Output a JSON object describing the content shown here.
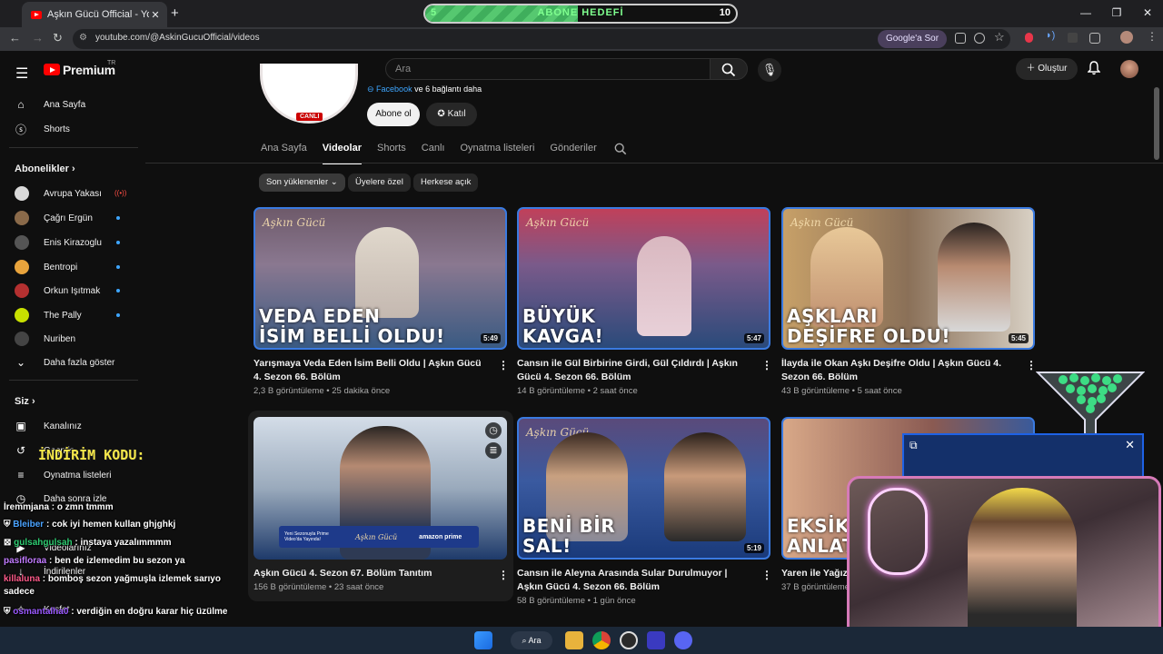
{
  "browser": {
    "tab_title": "Aşkın Gücü Official - YouTube",
    "tab_close": "✕",
    "new_tab": "+",
    "url": "youtube.com/@AskinGucuOfficial/videos",
    "google_sor": "Google'a Sor",
    "window_controls": [
      "—",
      "❐",
      "✕"
    ]
  },
  "abone_hedefi": {
    "label": "ABONE HEDEFİ",
    "start": "5",
    "end": "10",
    "progress_fraction": 0.49,
    "color": "#56c870"
  },
  "youtube": {
    "premium": "Premium",
    "premium_region": "TR",
    "search_placeholder": "Ara",
    "create_label": "Oluştur",
    "brand_color": "#ff0000"
  },
  "sidebar": {
    "main": [
      {
        "label": "Ana Sayfa",
        "icon": "home-icon"
      },
      {
        "label": "Shorts",
        "icon": "shorts-icon"
      }
    ],
    "subs_header": "Abonelikler",
    "subscriptions": [
      {
        "label": "Avrupa Yakası",
        "live": true
      },
      {
        "label": "Çağrı Ergün",
        "dot": true
      },
      {
        "label": "Enis Kirazoglu",
        "dot": true
      },
      {
        "label": "Bentropi",
        "dot": true
      },
      {
        "label": "Orkun Işıtmak",
        "dot": true
      },
      {
        "label": "The Pally",
        "dot": true
      },
      {
        "label": "Nuriben",
        "dot": false
      }
    ],
    "show_more": "Daha fazla göster",
    "you_header": "Siz",
    "you_items": [
      {
        "label": "Kanalınız",
        "icon": "channel-icon"
      },
      {
        "label": "Geçmiş",
        "icon": "history-icon"
      },
      {
        "label": "Oynatma listeleri",
        "icon": "playlist-icon"
      },
      {
        "label": "Daha sonra izle",
        "icon": "watch-later-icon"
      },
      {
        "label": "Videolarınız",
        "icon": "videos-icon"
      },
      {
        "label": "İndirilenler",
        "icon": "download-icon"
      },
      {
        "label": "Keşfet",
        "icon": "explore-icon"
      }
    ]
  },
  "channel": {
    "live_badge": "CANLI",
    "links_fb": "Facebook",
    "links_more": "ve 6 bağlantı daha",
    "subscribe": "Abone ol",
    "join": "Katıl",
    "tabs": [
      "Ana Sayfa",
      "Videolar",
      "Shorts",
      "Canlı",
      "Oynatma listeleri",
      "Gönderiler"
    ],
    "active_tab": "Videolar",
    "chips": [
      "Son yüklenenler",
      "Üyelere özel",
      "Herkese açık"
    ]
  },
  "videos": [
    {
      "title": "Yarışmaya Veda Eden İsim Belli Oldu | Aşkın Gücü 4. Sezon 66. Bölüm",
      "views": "2,3 B görüntüleme",
      "age": "25 dakika önce",
      "duration": "5:49",
      "caption1": "VEDA EDEN",
      "caption2": "İSİM BELLİ OLDU!",
      "brand": "Aşkın Gücü"
    },
    {
      "title": "Cansın ile Gül Birbirine Girdi, Gül Çıldırdı | Aşkın Gücü 4. Sezon 66. Bölüm",
      "views": "14 B görüntüleme",
      "age": "2 saat önce",
      "duration": "5:47",
      "caption1": "BÜYÜK",
      "caption2": "KAVGA!",
      "brand": "Aşkın Gücü"
    },
    {
      "title": "İlayda ile Okan Aşkı Deşifre Oldu | Aşkın Gücü 4. Sezon 66. Bölüm",
      "views": "43 B görüntüleme",
      "age": "5 saat önce",
      "duration": "5:45",
      "caption1": "AŞKLARI",
      "caption2": "DEŞİFRE OLDU!",
      "brand": "Aşkın Gücü"
    },
    {
      "title": "Aşkın Gücü 4. Sezon 67. Bölüm Tanıtım",
      "views": "156 B görüntüleme",
      "age": "23 saat önce",
      "duration": "",
      "caption1": "",
      "caption2": "",
      "brand": "Aşkın Gücü"
    },
    {
      "title": "Cansın ile Aleyna Arasında Sular Durulmuyor | Aşkın Gücü 4. Sezon 66. Bölüm",
      "views": "58 B görüntüleme",
      "age": "1 gün önce",
      "duration": "5:19",
      "caption1": "BENİ BİR",
      "caption2": "SAL!",
      "brand": "Aşkın Gücü"
    },
    {
      "title": "Yaren ile Yağız",
      "views": "37 B görüntüleme",
      "age": "",
      "duration": "",
      "caption1": "EKSİK",
      "caption2": "ANLAT",
      "brand": "Aşkın Gücü"
    }
  ],
  "promo_banner": {
    "text": "Yeni Sezonuyla Prime Video'da Yayında!",
    "partner": "amazon prime"
  },
  "overlay": {
    "promo_code": "İNDİRİM KODU:",
    "chat": [
      {
        "user": "İremmjana",
        "msg": "o zmn tmmm",
        "color": "#ffffff"
      },
      {
        "user": "Bleiber",
        "msg": "cok iyi hemen kullan ghjghkj",
        "color": "#4aa3ff"
      },
      {
        "user": "gulsahgulsah",
        "msg": "instaya yazalımmmm",
        "color": "#2ecc71"
      },
      {
        "user": "pasifloraa",
        "msg": "ben de izlemedim bu sezon ya",
        "color": "#c17bff"
      },
      {
        "user": "killaluna",
        "msg": "bomboş sezon yağmuşla izlemek sarıyo sadece",
        "color": "#ff5b8a"
      },
      {
        "user": "osmantalha0",
        "msg": "verdiğin en doğru karar hiç üzülme",
        "color": "#9b59ff"
      }
    ]
  },
  "taskbar": {
    "search": "Ara"
  }
}
